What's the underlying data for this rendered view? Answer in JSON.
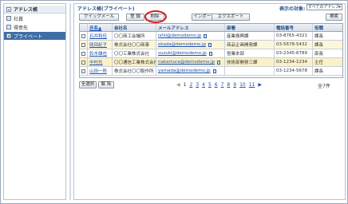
{
  "sidebar": {
    "items": [
      {
        "label": "アドレス帳",
        "icon": "minus-box-icon"
      },
      {
        "label": "社員",
        "icon": "address-book-icon"
      },
      {
        "label": "得意先",
        "icon": "address-book-icon"
      },
      {
        "label": "プライベート",
        "icon": "plus-box-icon"
      }
    ]
  },
  "main": {
    "title": "アドレス帳(プライベート)",
    "target_label": "表示の対象:",
    "target_value": "すべてのアドレス"
  },
  "toolbar": {
    "quick_label": "クイックメール",
    "register_label": "登 録",
    "delete_label": "削除",
    "import_label": "インポート",
    "export_label": "エクスポート",
    "search_label": "検索"
  },
  "table": {
    "headers": [
      "氏名▲",
      "会社名",
      "メールアドレス",
      "部署",
      "電話番号",
      "役職"
    ],
    "rows": [
      {
        "name": "石井和佳",
        "company": "〇〇商工会議所",
        "mail": "ishii@demodemo.jp",
        "dept": "産業振興課",
        "tel": "03-8765-4321",
        "title": "課長"
      },
      {
        "name": "岡田紀子",
        "company": "株式会社〇〇商事",
        "mail": "okada@demodemo.jp",
        "dept": "商品企画開発課",
        "tel": "03-5678-5432",
        "title": "課長"
      },
      {
        "name": "鈴木雄也",
        "company": "〇〇工業株式会社",
        "mail": "suzuki@demodemo.jp",
        "dept": "営業本部",
        "tel": "03-2345-6789",
        "title": "部長"
      },
      {
        "name": "中村光",
        "company": "〇〇通信工業株式会社",
        "mail": "nakamura@demodemo.jp",
        "dept": "技術部開発三課",
        "tel": "03-1234-1234",
        "title": "主任"
      },
      {
        "name": "山田一郎",
        "company": "株式会社〇〇製作所",
        "mail": "yamada@demodemo.jp",
        "dept": "",
        "tel": "03-1234-5678",
        "title": "課長"
      }
    ]
  },
  "footer": {
    "select_all": "全選択",
    "clear": "解 除",
    "pager": [
      "1",
      "2",
      "3",
      "4",
      "5",
      "6",
      "7",
      "8",
      "9",
      "10",
      "11",
      "▶"
    ],
    "pager_prev": "◀",
    "current_page": "1",
    "total": "全7件"
  }
}
